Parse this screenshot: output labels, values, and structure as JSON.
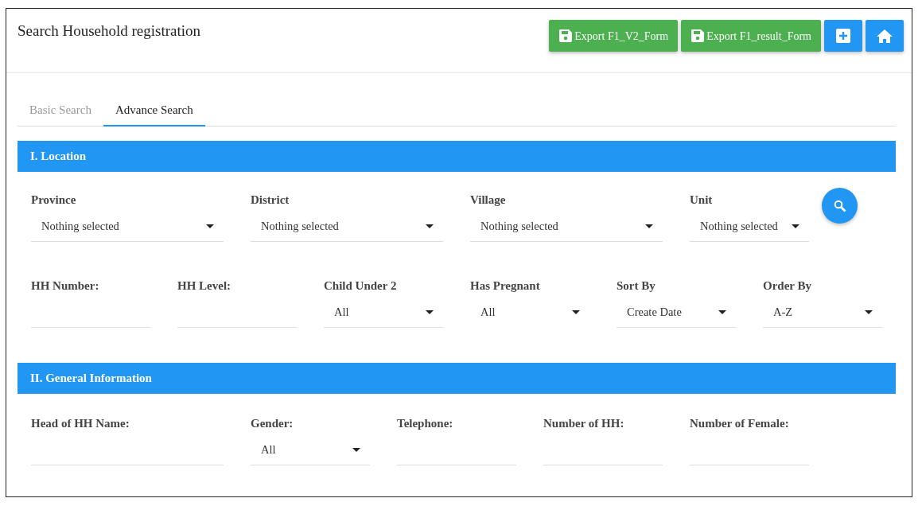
{
  "header": {
    "title": "Search Household registration",
    "buttons": [
      {
        "kind": "export",
        "label": "Export F1_V2_Form"
      },
      {
        "kind": "export",
        "label": "Export F1_result_Form"
      },
      {
        "kind": "add"
      },
      {
        "kind": "home"
      }
    ]
  },
  "tabs": [
    {
      "label": "Basic Search",
      "selected": false
    },
    {
      "label": "Advance Search",
      "selected": true
    }
  ],
  "sections": [
    {
      "title": "I. Location",
      "search_button": true,
      "rows": [
        {
          "fields": [
            {
              "label": "Province",
              "kind": "select",
              "value": "Nothing selected"
            },
            {
              "label": "District",
              "kind": "select",
              "value": "Nothing selected"
            },
            {
              "label": "Village",
              "kind": "select",
              "value": "Nothing selected"
            },
            {
              "label": "Unit",
              "kind": "select",
              "value": "Nothing selected"
            }
          ]
        },
        {
          "fields": [
            {
              "label": "HH Number:",
              "kind": "text"
            },
            {
              "label": "HH Level:",
              "kind": "text"
            },
            {
              "label": "Child Under 2",
              "kind": "select",
              "value": "All"
            },
            {
              "label": "Has Pregnant",
              "kind": "select",
              "value": "All",
              "underline": false
            },
            {
              "label": "Sort By",
              "kind": "select",
              "value": "Create Date"
            },
            {
              "label": "Order By",
              "kind": "select",
              "value": "A-Z"
            }
          ]
        }
      ]
    },
    {
      "title": "II. General Information",
      "rows": [
        {
          "fields": [
            {
              "label": "Head of HH Name:",
              "kind": "text"
            },
            {
              "label": "Gender:",
              "kind": "select",
              "value": "All"
            },
            {
              "label": "Telephone:",
              "kind": "text"
            },
            {
              "label": "Number of HH:",
              "kind": "text"
            },
            {
              "label": "Number of Female:",
              "kind": "text"
            }
          ]
        }
      ]
    }
  ]
}
